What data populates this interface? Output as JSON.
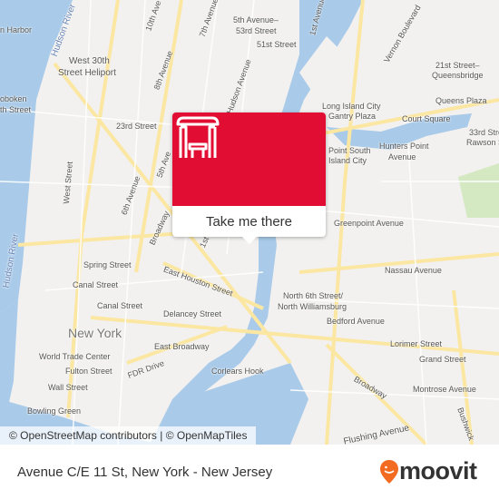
{
  "map": {
    "labels": [
      "n Harbor",
      "Hudson River",
      "West 30th",
      "Street Heliport",
      "oboken",
      "th Street",
      "10th Ave",
      "7th Avenue",
      "5th Avenue–",
      "53rd Street",
      "51st Street",
      "1st Avenue",
      "Vernon Boulevard",
      "21st Street–",
      "Queensbridge",
      "Queens Plaza",
      "Court Square",
      "33rd Street",
      "Rawson St",
      "Long Island City",
      "Gantry Plaza",
      "Hunters Point",
      "Avenue",
      "Point South",
      "Island City",
      "23rd Street",
      "8th Avenue",
      "Hudson Avenue",
      "West Street",
      "6th Avenue",
      "5th Ave",
      "Broadway",
      "Greenpoint Avenue",
      "1st Av",
      "Hudson River",
      "Spring Street",
      "Nassau Avenue",
      "East Houston Street",
      "Canal Street",
      "Canal Street",
      "North 6th Street/",
      "North Williamsburg",
      "Delancey Street",
      "Bedford Avenue",
      "New York",
      "East Broadway",
      "Lorimer Street",
      "World Trade Center",
      "Fulton Street",
      "FDR Drive",
      "Corlears Hook",
      "Grand Street",
      "Broadway",
      "Wall Street",
      "Montrose Avenue",
      "Bowling Green",
      "Flushing Avenue",
      "Bushwick"
    ],
    "attribution": "© OpenStreetMap contributors | © OpenMapTiles",
    "colors": {
      "water": "#a9cbe9",
      "land": "#f2f1ef",
      "road": "#fbe7a1",
      "park": "#d4e8c2"
    }
  },
  "popup": {
    "icon": "bus-stop-shelter-icon",
    "button_label": "Take me there",
    "color": "#e20d32"
  },
  "footer": {
    "title": "Avenue C/E 11 St, New York - New Jersey",
    "logo_text": "moovit",
    "logo_color": "#f26b21"
  }
}
